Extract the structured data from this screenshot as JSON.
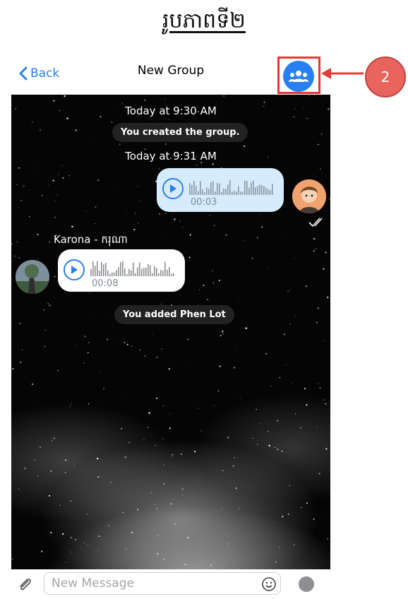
{
  "document_title": "រូបភាពទី២",
  "nav": {
    "back_label": "Back",
    "title": "New Group",
    "group_icon": "group-people-icon"
  },
  "callout": {
    "number": "2",
    "color": "#e8645c",
    "highlight_color": "#e53935"
  },
  "messages": {
    "time1": "Today at 9:30 AM",
    "created": "You created the group.",
    "time2": "Today at 9:31 AM",
    "outgoing_voice": {
      "duration": "00:03",
      "status_icon": "double-check-icon"
    },
    "karona_name": "Karona - ករុណា",
    "incoming_voice": {
      "duration": "00:08"
    },
    "added": "You added Phen Lot"
  },
  "composer": {
    "placeholder": "New Message",
    "attach_icon": "paperclip-icon",
    "emoji_icon": "smiley-icon",
    "send_icon": "record-dot-icon"
  },
  "colors": {
    "accent": "#2a7ff0",
    "outgoing_bubble": "#d6ecfc",
    "incoming_bubble": "#ffffff"
  }
}
